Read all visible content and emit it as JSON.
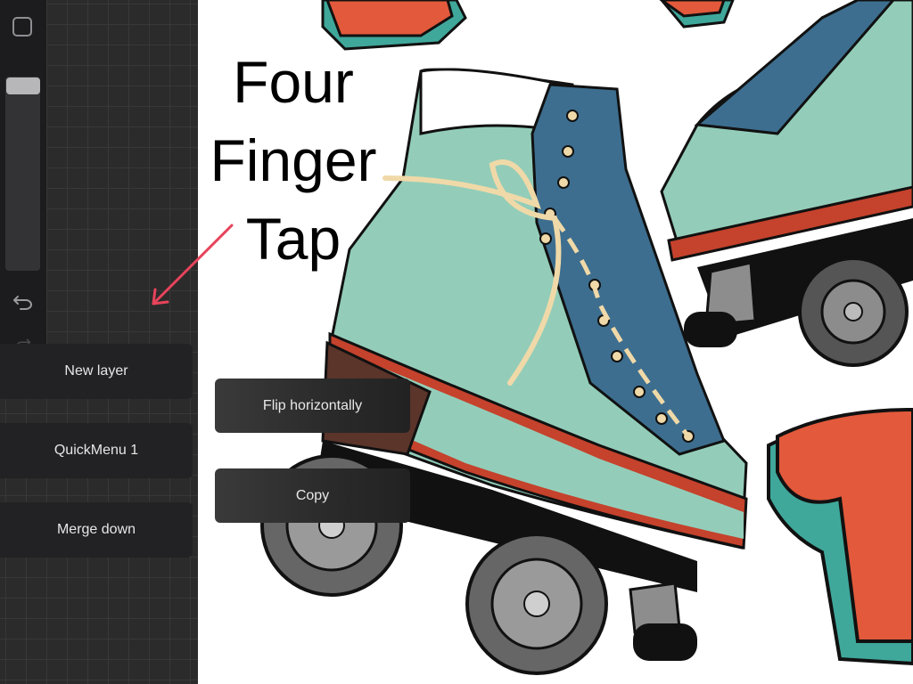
{
  "annotation": {
    "line1": "Four",
    "line2": "Finger",
    "line3": "Tap"
  },
  "quickmenu": {
    "left": [
      {
        "label": "New layer"
      },
      {
        "label": "QuickMenu 1"
      },
      {
        "label": "Merge down"
      }
    ],
    "right": [
      {
        "label": "Flip horizontally"
      },
      {
        "label": "Copy"
      }
    ]
  },
  "sidebar": {
    "icons": [
      "square-modify-icon",
      "size-slider",
      "undo-icon",
      "redo-icon"
    ]
  },
  "colors": {
    "skate_teal": "#93cdb9",
    "skate_blue": "#3d6e8f",
    "lace": "#f0d9a8",
    "sole_red": "#c5422c",
    "letter_orange": "#e2593b",
    "letter_teal": "#3fa89b",
    "arrow": "#e8435a"
  }
}
